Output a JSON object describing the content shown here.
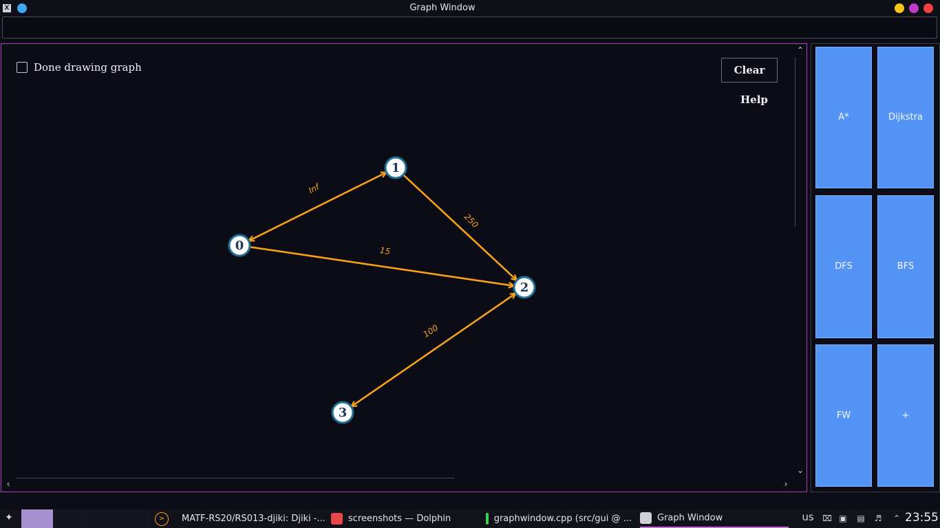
{
  "window": {
    "title": "Graph Window",
    "controls": {
      "minimize_color": "#f5c518",
      "maximize_color": "#c23ac8",
      "close_color": "#f04040"
    }
  },
  "canvas": {
    "checkbox_label": "Done drawing graph",
    "checkbox_checked": false,
    "clear_label": "Clear",
    "help_label": "Help"
  },
  "graph": {
    "edge_color": "#f7a21b",
    "node_stroke": "#1f6f95",
    "nodes": [
      {
        "id": "0",
        "label": "0"
      },
      {
        "id": "1",
        "label": "1"
      },
      {
        "id": "2",
        "label": "2"
      },
      {
        "id": "3",
        "label": "3"
      }
    ],
    "edges": [
      {
        "from": "0",
        "to": "1",
        "weight": "Inf",
        "bidirectional": true
      },
      {
        "from": "1",
        "to": "2",
        "weight": "250",
        "bidirectional": false
      },
      {
        "from": "0",
        "to": "2",
        "weight": "15",
        "bidirectional": false
      },
      {
        "from": "3",
        "to": "2",
        "weight": "100",
        "bidirectional": true
      }
    ]
  },
  "algorithms": {
    "color": "#5494f5",
    "buttons": [
      {
        "label": "A*"
      },
      {
        "label": "Dijkstra"
      },
      {
        "label": "DFS"
      },
      {
        "label": "BFS"
      },
      {
        "label": "FW"
      },
      {
        "label": "+"
      }
    ]
  },
  "taskbar": {
    "tasks": [
      {
        "label": "MATF-RS20/RS013-djiki: Djiki -...",
        "icon": "chrome-icon"
      },
      {
        "label": "screenshots — Dolphin",
        "icon": "folder-icon"
      },
      {
        "label": "graphwindow.cpp (src/gui @ ...",
        "icon": "qtcreator-icon"
      },
      {
        "label": "Graph Window",
        "icon": "x-app-icon"
      }
    ],
    "keyboard_layout": "us",
    "clock": "23:55"
  }
}
